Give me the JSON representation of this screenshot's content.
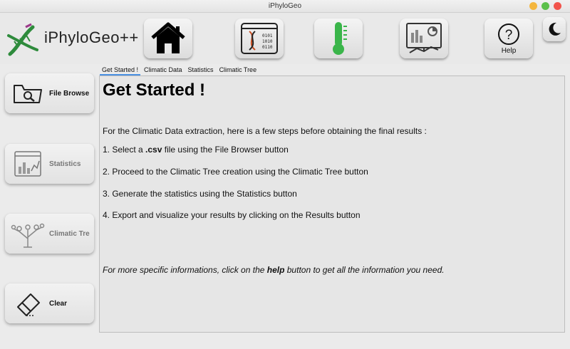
{
  "window": {
    "title": "iPhyloGeo"
  },
  "app": {
    "name": "iPhyloGeo++"
  },
  "toolbar": {
    "home_icon": "home-icon",
    "dna_icon": "dna-icon",
    "thermometer_icon": "thermometer-icon",
    "stats_icon": "stats-dashboard-icon",
    "help_label": "Help",
    "theme_icon": "moon-icon"
  },
  "sidebar": {
    "file_browse": "File Browse",
    "statistics": "Statistics",
    "climatic_tree": "Climatic Tre",
    "clear": "Clear"
  },
  "tabs": [
    "Get Started !",
    "Climatic Data",
    "Statistics",
    "Climatic Tree"
  ],
  "content": {
    "title": "Get Started !",
    "intro": "For the Climatic Data extraction, here is a few steps before obtaining the final results :",
    "step1_pre": "1. Select a ",
    "step1_bold": ".csv",
    "step1_post": " file using the File Browser button",
    "step2": "2. Proceed to the Climatic Tree creation using the Climatic Tree button",
    "step3": "3. Generate the statistics using the Statistics button",
    "step4": "4. Export and visualize your results by clicking on the Results button",
    "note_pre": "For more specific informations, click on the ",
    "note_bold": "help",
    "note_post": " button to get all the information you need."
  },
  "colors": {
    "accent": "#4a90e2",
    "logo_green": "#2e8b3c",
    "thermo_green": "#3ab54a"
  }
}
